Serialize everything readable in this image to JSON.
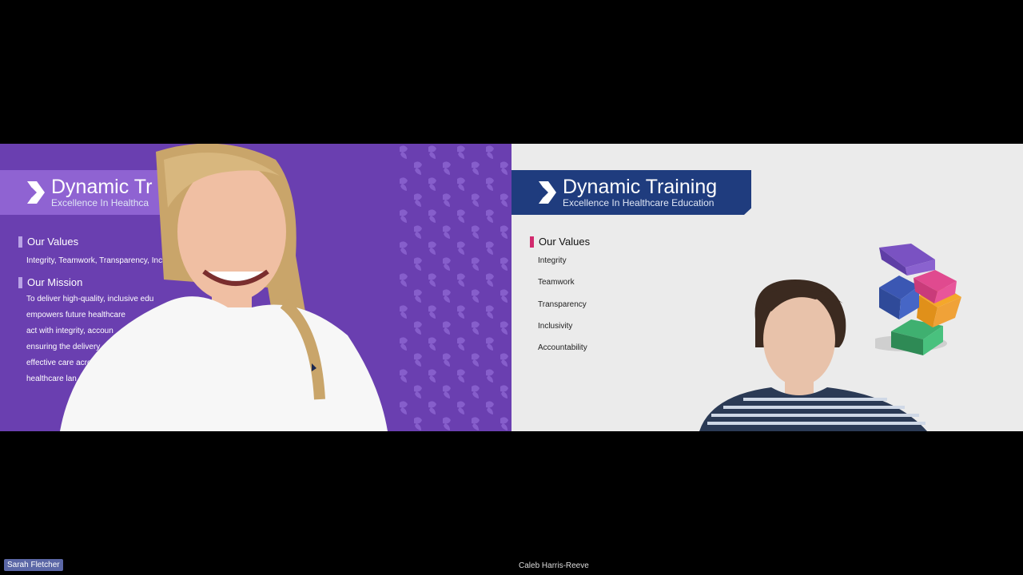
{
  "participants": [
    {
      "name": "Sarah Fletcher",
      "slide": {
        "brand_name": "Dynamic Tr",
        "brand_tagline": "Excellence In Healthca",
        "values_title": "Our Values",
        "values_text": "Integrity, Teamwork, Transparency,  Inclu",
        "mission_title": "Our Mission",
        "mission_lines": [
          "To deliver high-quality, inclusive edu",
          "empowers future healthcare",
          "act with integrity, accoun",
          "ensuring the delivery",
          "effective care acro",
          "healthcare lan"
        ]
      }
    },
    {
      "name": "Caleb Harris-Reeve",
      "slide": {
        "brand_name": "Dynamic Training",
        "brand_tagline": "Excellence In Healthcare Education",
        "values_title": "Our Values",
        "values_items": [
          "Integrity",
          "Teamwork",
          "Transparency",
          "Inclusivity",
          "Accountability"
        ]
      }
    }
  ],
  "colors": {
    "left_background": "#6a3fb0",
    "right_background": "#ebebeb",
    "banner_blue": "#1f3c7e",
    "accent_pink": "#d12a6e",
    "name_label_bg": "#5b67a6"
  }
}
